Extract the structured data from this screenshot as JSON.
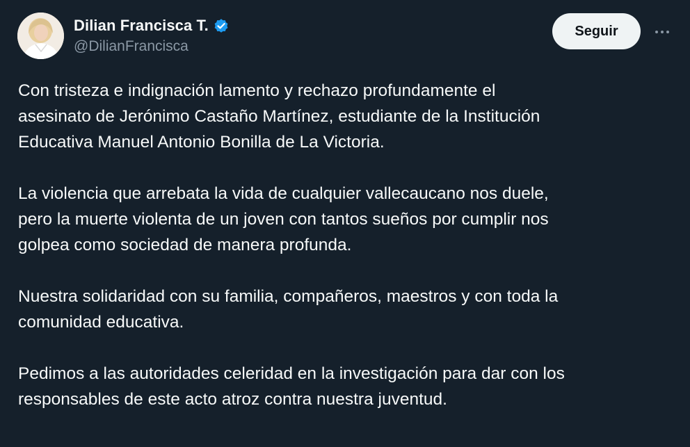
{
  "author": {
    "display_name": "Dilian Francisca T.",
    "handle": "@DilianFrancisca",
    "verified_icon": "verified-badge-icon",
    "avatar_icon": "profile-photo"
  },
  "actions": {
    "follow_label": "Seguir",
    "more_icon": "more-options-icon"
  },
  "tweet": {
    "paragraphs": [
      "Con tristeza e indignación lamento y rechazo profundamente el\nasesinato de Jerónimo Castaño Martínez, estudiante de la Institución\nEducativa Manuel Antonio Bonilla de La Victoria.",
      "La violencia que arrebata la vida de cualquier vallecaucano nos duele,\npero la muerte violenta de un joven con tantos sueños por cumplir nos\ngolpea como sociedad de manera profunda.",
      "Nuestra solidaridad con su familia, compañeros, maestros y con toda la\ncomunidad educativa.",
      "Pedimos a las autoridades celeridad en la investigación para dar con los\nresponsables de este acto atroz contra nuestra juventud."
    ]
  },
  "colors": {
    "background": "#15202b",
    "text": "#f7f9f9",
    "secondary_text": "#8b98a5",
    "verified_blue": "#1d9bf0",
    "follow_button_bg": "#eff3f4"
  }
}
